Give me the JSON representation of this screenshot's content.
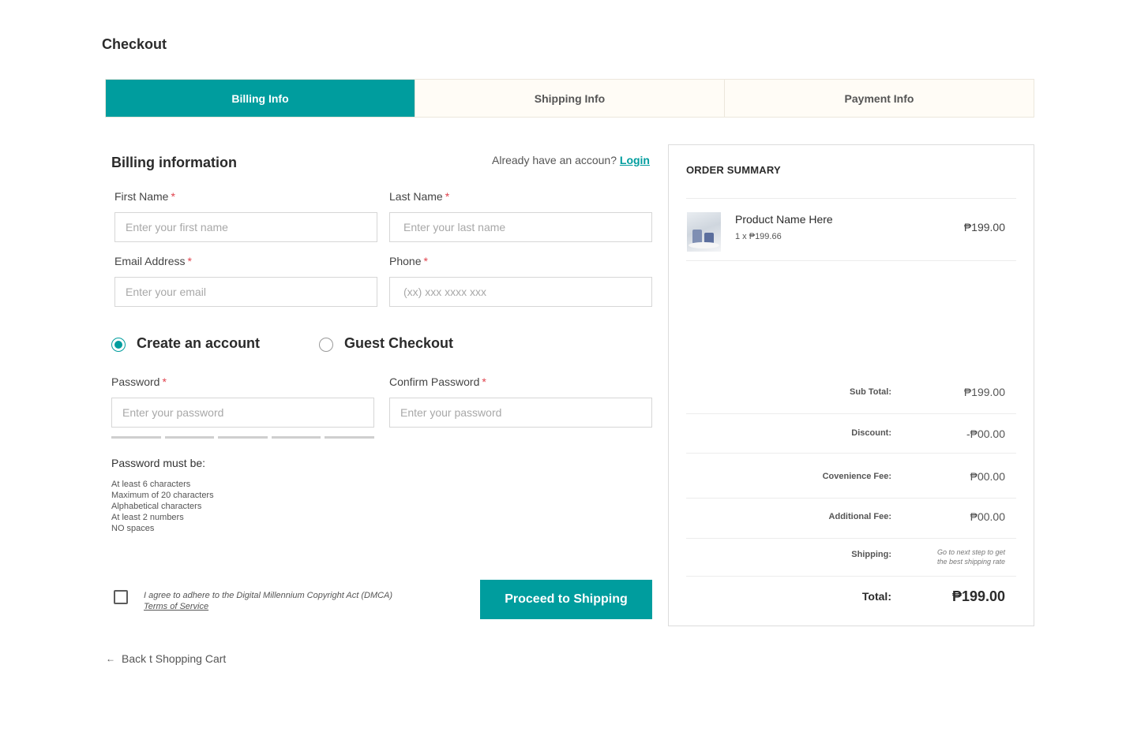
{
  "page": {
    "title": "Checkout"
  },
  "steps": [
    {
      "label": "Billing Info",
      "active": true
    },
    {
      "label": "Shipping Info",
      "active": false
    },
    {
      "label": "Payment Info",
      "active": false
    }
  ],
  "billing": {
    "title": "Billing information",
    "login_prompt": "Already have an accoun?",
    "login_label": "Login",
    "first_name": {
      "label": "First Name",
      "placeholder": "Enter your first name",
      "value": ""
    },
    "last_name": {
      "label": "Last Name",
      "placeholder": "Enter your last name",
      "value": ""
    },
    "email": {
      "label": "Email Address",
      "placeholder": "Enter your email",
      "value": ""
    },
    "phone": {
      "label": "Phone",
      "placeholder": "(xx) xxx xxxx xxx",
      "value": ""
    },
    "required_mark": "*"
  },
  "account_options": {
    "create_label": "Create an account",
    "guest_label": "Guest Checkout",
    "selected": "create"
  },
  "password": {
    "label": "Password",
    "placeholder": "Enter your password",
    "confirm_label": "Confirm Password",
    "confirm_placeholder": "Enter your password",
    "strength_level": 0,
    "strength_segments": 5,
    "rules_title": "Password must be:",
    "rules": [
      "At least 6 characters",
      "Maximum of 20 characters",
      "Alphabetical characters",
      "At least 2 numbers",
      "NO spaces"
    ]
  },
  "agreement": {
    "text": "I agree to adhere to the Digital Millennium Copyright Act (DMCA)",
    "tos_label": "Terms of Service",
    "checked": false
  },
  "actions": {
    "proceed_label": "Proceed to Shipping",
    "back_label": "Back t Shopping Cart"
  },
  "summary": {
    "title": "ORDER SUMMARY",
    "product": {
      "name": "Product Name Here",
      "qty_price": "1 x ₱199.66",
      "price": "₱199.00"
    },
    "lines": {
      "subtotal_label": "Sub Total:",
      "subtotal_value": "₱199.00",
      "discount_label": "Discount:",
      "discount_value": "-₱00.00",
      "convenience_label": "Covenience Fee:",
      "convenience_value": "₱00.00",
      "additional_label": "Additional Fee:",
      "additional_value": "₱00.00",
      "shipping_label": "Shipping:",
      "shipping_note_1": "Go to next step to get",
      "shipping_note_2": "the best shipping rate",
      "total_label": "Total:",
      "total_value": "₱199.00"
    }
  },
  "colors": {
    "accent": "#009d9e",
    "required": "#e0424d",
    "tab_inactive_bg": "#fffcf6"
  }
}
